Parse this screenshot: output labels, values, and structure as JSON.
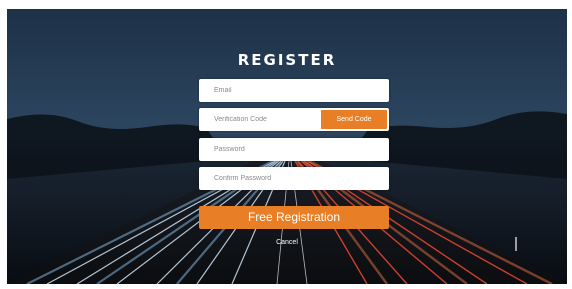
{
  "form": {
    "title": "REGISTER",
    "email_placeholder": "Email",
    "code_placeholder": "Verification Code",
    "send_code_label": "Send Code",
    "password_placeholder": "Password",
    "confirm_placeholder": "Confirm Password",
    "submit_label": "Free Registration",
    "cancel_label": "Cancel"
  },
  "colors": {
    "accent": "#e87f26",
    "sky": "#1b2c40",
    "light_trail_red": "#e2452e",
    "light_trail_blue": "#9fc4e6"
  },
  "background": {
    "description_icon": "highway-light-trails-image"
  }
}
